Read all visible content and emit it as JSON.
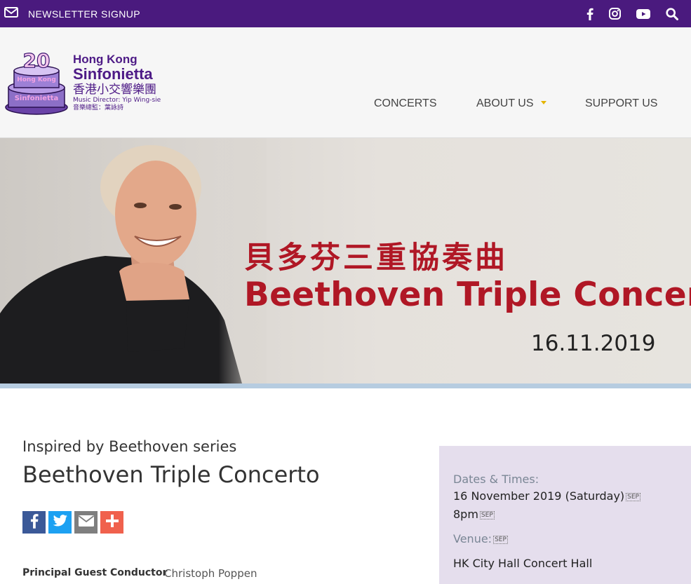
{
  "topbar": {
    "newsletter_label": "NEWSLETTER SIGNUP",
    "icons": [
      "mail-icon",
      "facebook-icon",
      "instagram-icon",
      "youtube-icon",
      "search-icon"
    ]
  },
  "logo": {
    "anniversary": "20",
    "cake_line1": "Hong Kong",
    "cake_line2": "Sinfonietta",
    "name_en_line1": "Hong Kong",
    "name_en_line2": "Sinfonietta",
    "name_zh": "香港小交響樂團",
    "music_director_en": "Music Director: Yip Wing-sie",
    "music_director_zh": "音樂總監：葉詠詩"
  },
  "nav": {
    "concerts": "CONCERTS",
    "about": "ABOUT US",
    "support": "SUPPORT US"
  },
  "hero": {
    "title_zh": "貝多芬三重協奏曲",
    "title_en": "Beethoven Triple Concerto",
    "date": "16.11.2019"
  },
  "page": {
    "series": "Inspired by Beethoven series",
    "title": "Beethoven Triple Concerto"
  },
  "share": {
    "buttons": [
      "facebook-share",
      "twitter-share",
      "email-share",
      "more-share"
    ]
  },
  "credits": [
    {
      "role": "Principal Guest Conductor",
      "name": "Christoph Poppen"
    }
  ],
  "info": {
    "dates_label": "Dates & Times:",
    "date_value": "16 November 2019 (Saturday)",
    "time_value": "8pm",
    "venue_label": "Venue:",
    "venue_value": "HK City Hall Concert Hall",
    "sep_glyph": "SEP"
  },
  "colors": {
    "topbar": "#4a1a7e",
    "brand_purple": "#4d1a86",
    "hero_red": "#b01725",
    "info_bg": "#e5deed",
    "caret": "#e4b400",
    "facebook": "#3b5998",
    "twitter": "#1da1f2",
    "email": "#7f7f7f",
    "more": "#f0614d"
  }
}
